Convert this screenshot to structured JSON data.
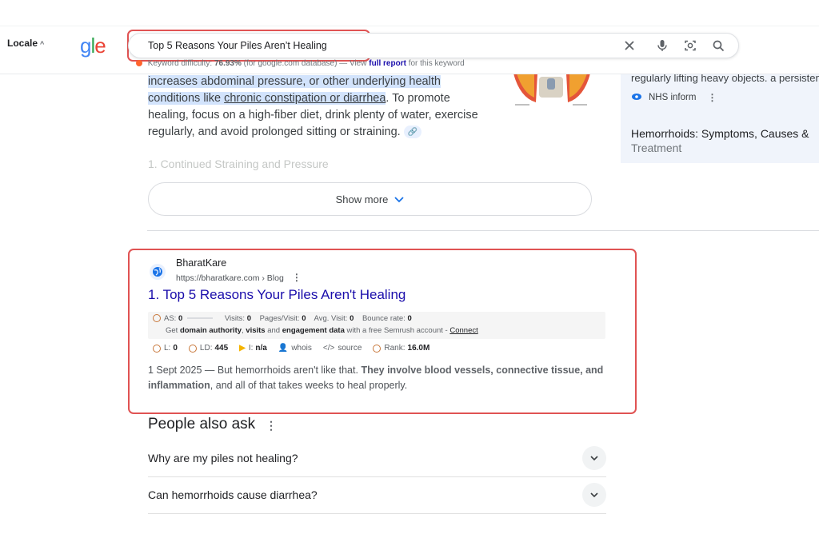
{
  "header": {
    "locale_label": "Locale",
    "logo_visible": "gle",
    "search": {
      "value": "Top 5 Reasons Your Piles Aren’t Healing"
    },
    "keyword_line": {
      "prefix": "Keyword difficulty:",
      "percent": "76.93%",
      "mid": "(for google.com database) — View",
      "link": "full report",
      "suffix": "for this keyword"
    }
  },
  "snippet": {
    "line1": "increases abdominal pressure, or other underlying health",
    "line2a": "conditions like",
    "line2b": "chronic constipation or diarrhea",
    "line2c": ". To promote",
    "line3": "healing, focus on a high-fiber diet, drink plenty of water, exercise",
    "line4": "regularly, and avoid prolonged sitting or straining.",
    "next_heading": "1. Continued Straining and Pressure",
    "show_more": "Show more"
  },
  "right_panel": {
    "text": "regularly lifting heavy objects. a persistent",
    "source": "NHS inform",
    "title": "Hemorrhoids: Symptoms, Causes &",
    "title_line2": "Treatment"
  },
  "result": {
    "site_name": "BharatKare",
    "url": "https://bharatkare.com › Blog",
    "title": "1. Top 5 Reasons Your Piles Aren't Healing",
    "semrush": {
      "as_label": "AS:",
      "as_value": "0",
      "visits_label": "Visits:",
      "visits_value": "0",
      "pages_label": "Pages/Visit:",
      "pages_value": "0",
      "avg_label": "Avg. Visit:",
      "avg_value": "0",
      "bounce_label": "Bounce rate:",
      "bounce_value": "0",
      "promo_a": "Get",
      "promo_b": "domain authority",
      "promo_c": ",",
      "promo_d": "visits",
      "promo_e": "and",
      "promo_f": "engagement data",
      "promo_g": "with a free Semrush account -",
      "promo_link": "Connect",
      "l_label": "L:",
      "l_value": "0",
      "ld_label": "LD:",
      "ld_value": "445",
      "i_label": "I:",
      "i_value": "n/a",
      "whois": "whois",
      "source": "source",
      "rank_label": "Rank:",
      "rank_value": "16.0M"
    },
    "desc_a": "1 Sept 2025 — But hemorrhoids aren't like that.",
    "desc_b": "They involve blood vessels, connective tissue, and",
    "desc_c": "inflammation",
    "desc_d": ", and all of that takes weeks to heal properly."
  },
  "paa": {
    "title": "People also ask",
    "questions": [
      "Why are my piles not healing?",
      "Can hemorrhoids cause diarrhea?"
    ]
  },
  "colors": {
    "link": "#1a0dab",
    "highlight": "#d2e3fc",
    "red_box": "#e05353"
  }
}
